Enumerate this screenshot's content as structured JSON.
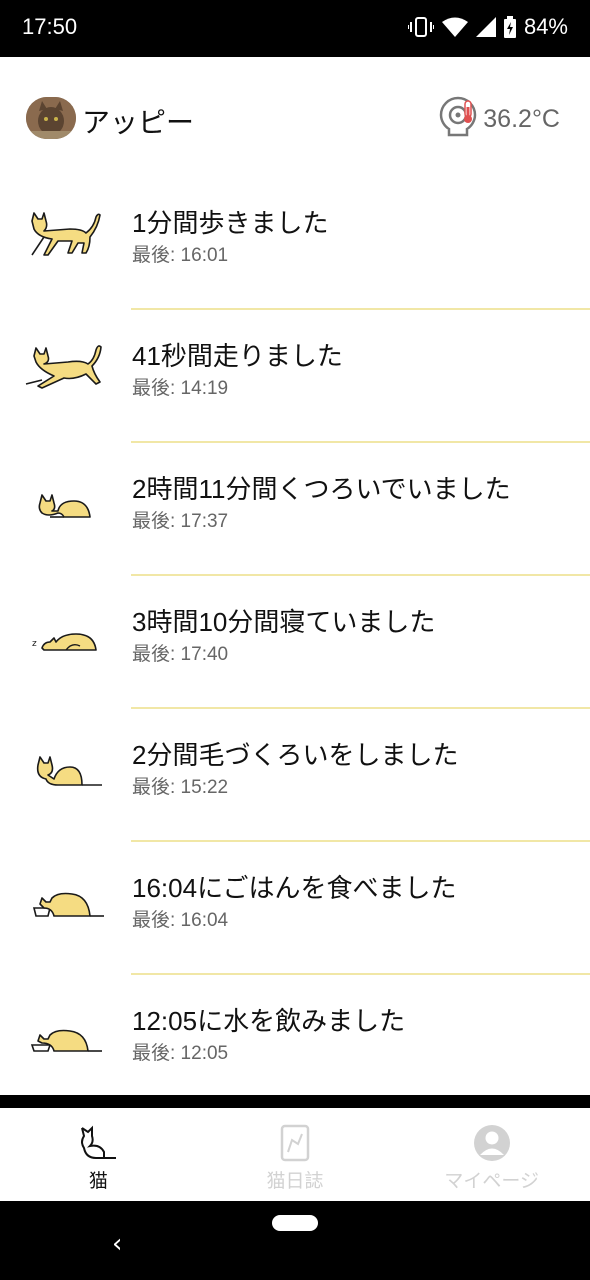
{
  "status_bar": {
    "time": "17:50",
    "battery": "84%",
    "icons": [
      "vibrate-icon",
      "wifi-icon",
      "signal-icon",
      "battery-icon"
    ]
  },
  "header": {
    "cat_name": "アッピー",
    "temperature": "36.2°C"
  },
  "activities": [
    {
      "icon": "walking-cat-icon",
      "title": "1分間歩きました",
      "last": "最後: 16:01"
    },
    {
      "icon": "running-cat-icon",
      "title": "41秒間走りました",
      "last": "最後: 14:19"
    },
    {
      "icon": "resting-cat-icon",
      "title": "2時間11分間くつろいでいました",
      "last": "最後: 17:37"
    },
    {
      "icon": "sleeping-cat-icon",
      "title": "3時間10分間寝ていました",
      "last": "最後: 17:40"
    },
    {
      "icon": "grooming-cat-icon",
      "title": "2分間毛づくろいをしました",
      "last": "最後: 15:22"
    },
    {
      "icon": "eating-cat-icon",
      "title": "16:04にごはんを食べました",
      "last": "最後: 16:04"
    },
    {
      "icon": "drinking-cat-icon",
      "title": "12:05に水を飲みました",
      "last": "最後: 12:05"
    }
  ],
  "tabs": [
    {
      "label": "猫",
      "icon": "cat-icon",
      "active": true
    },
    {
      "label": "猫日誌",
      "icon": "diary-icon",
      "active": false
    },
    {
      "label": "マイページ",
      "icon": "profile-icon",
      "active": false
    }
  ],
  "colors": {
    "cat_fill": "#f5dc82",
    "cat_stroke": "#1a1a1a",
    "divider": "#f1e7a6",
    "inactive_tab": "#d2d2d2"
  }
}
